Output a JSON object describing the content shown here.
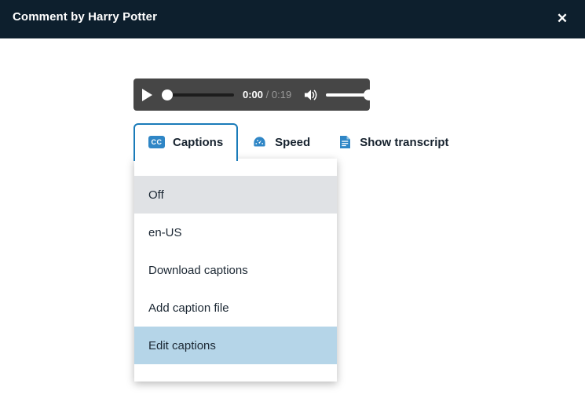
{
  "header": {
    "title": "Comment by Harry Potter",
    "close_label": "✕",
    "close_icon": "close-icon",
    "background_color": "#0d1f2d"
  },
  "player": {
    "play_icon": "play-icon",
    "play_label": "Play",
    "current_time": "0:00",
    "separator": "/",
    "duration": "0:19",
    "volume_icon": "volume-icon",
    "scrub_position_percent": 0,
    "volume_percent": 100,
    "background_color": "#464646"
  },
  "toolbar": {
    "items": [
      {
        "label": "Captions",
        "icon": "cc-icon",
        "icon_text": "CC",
        "active": true
      },
      {
        "label": "Speed",
        "icon": "speedometer-icon",
        "active": false
      },
      {
        "label": "Show transcript",
        "icon": "document-icon",
        "active": false
      }
    ],
    "accent_color": "#1a7bb9",
    "icon_color": "#2f86c6"
  },
  "captions_menu": {
    "items": [
      {
        "label": "Off",
        "state": "selected"
      },
      {
        "label": "en-US",
        "state": "normal"
      },
      {
        "label": "Download captions",
        "state": "normal"
      },
      {
        "label": "Add caption file",
        "state": "normal"
      },
      {
        "label": "Edit captions",
        "state": "hovered"
      }
    ],
    "selected_color": "#e0e2e5",
    "hover_color": "#b5d5e8"
  }
}
